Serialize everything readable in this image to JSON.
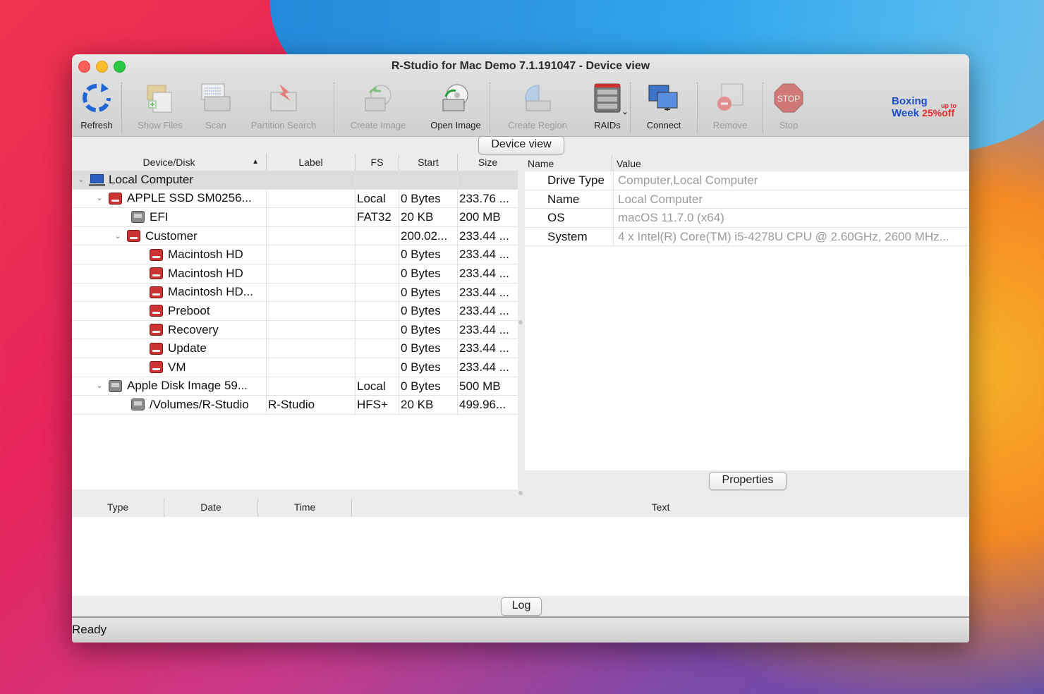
{
  "window": {
    "title": "R-Studio for Mac Demo 7.1.191047 - Device view"
  },
  "toolbar": {
    "refresh": "Refresh",
    "show_files": "Show Files",
    "scan": "Scan",
    "partition_search": "Partition Search",
    "create_image": "Create Image",
    "open_image": "Open Image",
    "create_region": "Create Region",
    "raids": "RAIDs",
    "connect": "Connect",
    "remove": "Remove",
    "stop": "Stop",
    "promo_line1": "Boxing",
    "promo_up": "up to",
    "promo_line2": "Week",
    "promo_pct": "25%off"
  },
  "device_view": {
    "title": "Device view",
    "columns": {
      "device": "Device/Disk",
      "label": "Label",
      "fs": "FS",
      "start": "Start",
      "size": "Size"
    },
    "rows": [
      {
        "name": "Local Computer",
        "label": "",
        "fs": "",
        "start": "",
        "size": ""
      },
      {
        "name": "APPLE SSD SM0256...",
        "label": "",
        "fs": "Local",
        "start": "0 Bytes",
        "size": "233.76 ..."
      },
      {
        "name": "EFI",
        "label": "",
        "fs": "FAT32",
        "start": "20 KB",
        "size": "200 MB"
      },
      {
        "name": "Customer",
        "label": "",
        "fs": "",
        "start": "200.02...",
        "size": "233.44 ..."
      },
      {
        "name": "Macintosh HD",
        "label": "",
        "fs": "",
        "start": "0 Bytes",
        "size": "233.44 ..."
      },
      {
        "name": "Macintosh HD",
        "label": "",
        "fs": "",
        "start": "0 Bytes",
        "size": "233.44 ..."
      },
      {
        "name": "Macintosh HD...",
        "label": "",
        "fs": "",
        "start": "0 Bytes",
        "size": "233.44 ..."
      },
      {
        "name": "Preboot",
        "label": "",
        "fs": "",
        "start": "0 Bytes",
        "size": "233.44 ..."
      },
      {
        "name": "Recovery",
        "label": "",
        "fs": "",
        "start": "0 Bytes",
        "size": "233.44 ..."
      },
      {
        "name": "Update",
        "label": "",
        "fs": "",
        "start": "0 Bytes",
        "size": "233.44 ..."
      },
      {
        "name": "VM",
        "label": "",
        "fs": "",
        "start": "0 Bytes",
        "size": "233.44 ..."
      },
      {
        "name": "Apple Disk Image 59...",
        "label": "",
        "fs": "Local",
        "start": "0 Bytes",
        "size": "500 MB"
      },
      {
        "name": "/Volumes/R-Studio",
        "label": "R-Studio",
        "fs": "HFS+",
        "start": "20 KB",
        "size": "499.96..."
      }
    ]
  },
  "properties": {
    "columns": {
      "name": "Name",
      "value": "Value"
    },
    "rows": [
      {
        "name": "Drive Type",
        "value": "Computer,Local Computer"
      },
      {
        "name": "Name",
        "value": "Local Computer"
      },
      {
        "name": "OS",
        "value": "macOS 11.7.0 (x64)"
      },
      {
        "name": "System",
        "value": "4 x Intel(R) Core(TM) i5-4278U CPU @ 2.60GHz, 2600 MHz..."
      }
    ],
    "button": "Properties"
  },
  "log": {
    "columns": {
      "type": "Type",
      "date": "Date",
      "time": "Time",
      "text": "Text"
    },
    "button": "Log"
  },
  "status": {
    "text": "Ready"
  }
}
